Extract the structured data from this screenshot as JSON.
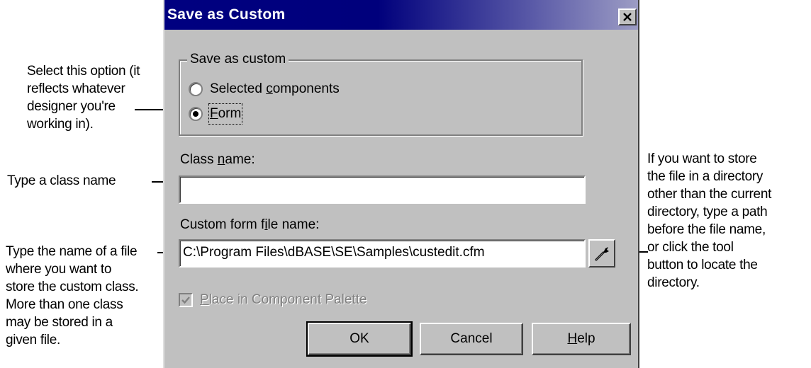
{
  "dialog": {
    "title": "Save as Custom",
    "close_glyph": "✕",
    "group": {
      "legend": "Save as custom",
      "options": [
        {
          "pre": "Selected ",
          "mnemonic": "c",
          "post": "omponents",
          "selected": false
        },
        {
          "pre": "",
          "mnemonic": "F",
          "post": "orm",
          "selected": true
        }
      ]
    },
    "class_name": {
      "label_pre": "Class ",
      "label_mnemonic": "n",
      "label_post": "ame:",
      "value": ""
    },
    "file_name": {
      "label_pre": "Custom form f",
      "label_mnemonic": "i",
      "label_post": "le name:",
      "value": "C:\\Program Files\\dBASE\\SE\\Samples\\custedit.cfm"
    },
    "tool_button_icon": "wrench-icon",
    "palette_checkbox": {
      "checked": true,
      "enabled": false,
      "label_mnemonic": "P",
      "label_rest": "lace in Component Palette"
    },
    "buttons": {
      "ok": "OK",
      "cancel": "Cancel",
      "help_mnemonic": "H",
      "help_rest": "elp"
    }
  },
  "callouts": {
    "option": "Select this option (it\nreflects whatever\ndesigner you're\nworking in).",
    "class_name": "Type a class name",
    "file_name": "Type the name of a file\nwhere you want to\nstore the custom class.\nMore than one class\nmay be stored in a\ngiven file.",
    "tool": "If you want to store\nthe file in a directory\nother than the current\ndirectory, type a path\nbefore the file name,\nor click the tool\nbutton to locate the\ndirectory."
  }
}
